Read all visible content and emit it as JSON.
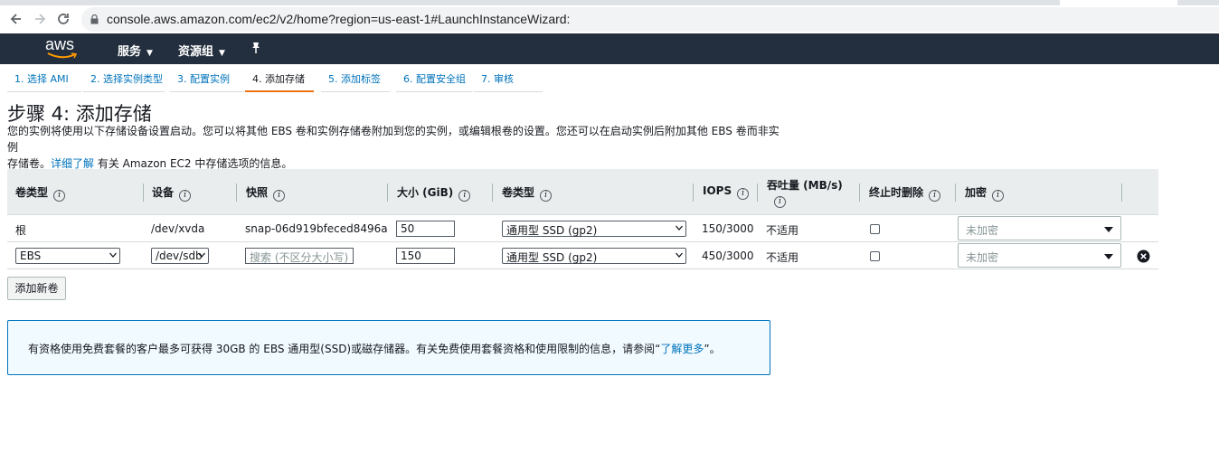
{
  "browser": {
    "url": "console.aws.amazon.com/ec2/v2/home?region=us-east-1#LaunchInstanceWizard:"
  },
  "header": {
    "logo": "aws",
    "services": "服务",
    "resource_groups": "资源组"
  },
  "wizard": {
    "tabs": [
      {
        "label": "1. 选择 AMI"
      },
      {
        "label": "2. 选择实例类型"
      },
      {
        "label": "3. 配置实例"
      },
      {
        "label": "4. 添加存储"
      },
      {
        "label": "5. 添加标签"
      },
      {
        "label": "6. 配置安全组"
      },
      {
        "label": "7. 审核"
      }
    ],
    "active_tab": 3
  },
  "page": {
    "title": "步骤 4: 添加存储",
    "desc_line1": "您的实例将使用以下存储设备设置启动。您可以将其他 EBS 卷和实例存储卷附加到您的实例，或编辑根卷的设置。您还可以在启动实例后附加其他 EBS 卷而非实例",
    "desc_line2_pre": "存储卷。",
    "desc_link": "详细了解",
    "desc_line2_post": " 有关 Amazon EC2 中存储选项的信息。"
  },
  "table": {
    "headers": {
      "volume_type": "卷类型",
      "device": "设备",
      "snapshot": "快照",
      "size": "大小 (GiB)",
      "vol_kind": "卷类型",
      "iops": "IOPS",
      "throughput": "吞吐量 (MB/s)",
      "delete_on_term": "终止时删除",
      "encryption": "加密"
    },
    "rows": [
      {
        "volume_type": "根",
        "device": "/dev/xvda",
        "snapshot": "snap-06d919bfeced8496a",
        "size": "50",
        "vol_kind": "通用型 SSD (gp2)",
        "iops": "150/3000",
        "throughput": "不适用",
        "delete_on_term": false,
        "encryption": "未加密"
      },
      {
        "volume_type": "EBS",
        "device": "/dev/sdb",
        "snapshot_placeholder": "搜索 (不区分大小写)",
        "size": "150",
        "vol_kind": "通用型 SSD (gp2)",
        "iops": "450/3000",
        "throughput": "不适用",
        "delete_on_term": false,
        "encryption": "未加密"
      }
    ]
  },
  "add_volume_button": "添加新卷",
  "notice": {
    "text": "有资格使用免费套餐的客户最多可获得 30GB 的 EBS 通用型(SSD)或磁存储器。有关免费使用套餐资格和使用限制的信息，请参阅“",
    "link": "了解更多",
    "text_end": "”。"
  },
  "colors": {
    "header_bg": "#232f3e",
    "link": "#0073bb",
    "active_tab_underline": "#ec7211",
    "notice_bg": "#f1faff"
  }
}
